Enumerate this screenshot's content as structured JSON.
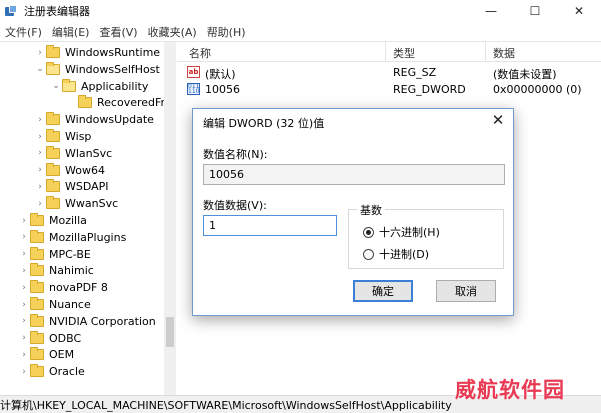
{
  "window": {
    "title": "注册表编辑器",
    "minimize": "—",
    "maximize": "☐",
    "close": "✕"
  },
  "menu": [
    "文件(F)",
    "编辑(E)",
    "查看(V)",
    "收藏夹(A)",
    "帮助(H)"
  ],
  "tree": [
    {
      "label": "WindowsRuntime",
      "depth": 3,
      "chev": "›",
      "open": false
    },
    {
      "label": "WindowsSelfHost",
      "depth": 3,
      "chev": "⌄",
      "open": true
    },
    {
      "label": "Applicability",
      "depth": 4,
      "chev": "⌄",
      "open": true
    },
    {
      "label": "RecoveredFr",
      "depth": 5,
      "chev": "",
      "open": false,
      "selected": true
    },
    {
      "label": "WindowsUpdate",
      "depth": 3,
      "chev": "›",
      "open": false
    },
    {
      "label": "Wisp",
      "depth": 3,
      "chev": "›",
      "open": false
    },
    {
      "label": "WlanSvc",
      "depth": 3,
      "chev": "›",
      "open": false
    },
    {
      "label": "Wow64",
      "depth": 3,
      "chev": "›",
      "open": false
    },
    {
      "label": "WSDAPI",
      "depth": 3,
      "chev": "›",
      "open": false
    },
    {
      "label": "WwanSvc",
      "depth": 3,
      "chev": "›",
      "open": false
    },
    {
      "label": "Mozilla",
      "depth": 2,
      "chev": "›",
      "open": false
    },
    {
      "label": "MozillaPlugins",
      "depth": 2,
      "chev": "›",
      "open": false
    },
    {
      "label": "MPC-BE",
      "depth": 2,
      "chev": "›",
      "open": false
    },
    {
      "label": "Nahimic",
      "depth": 2,
      "chev": "›",
      "open": false
    },
    {
      "label": "novaPDF 8",
      "depth": 2,
      "chev": "›",
      "open": false
    },
    {
      "label": "Nuance",
      "depth": 2,
      "chev": "›",
      "open": false
    },
    {
      "label": "NVIDIA Corporation",
      "depth": 2,
      "chev": "›",
      "open": false
    },
    {
      "label": "ODBC",
      "depth": 2,
      "chev": "›",
      "open": false
    },
    {
      "label": "OEM",
      "depth": 2,
      "chev": "›",
      "open": false
    },
    {
      "label": "Oracle",
      "depth": 2,
      "chev": "›",
      "open": false
    }
  ],
  "list": {
    "columns": [
      "名称",
      "类型",
      "数据"
    ],
    "rows": [
      {
        "icon": "string-value-icon",
        "icon_text": "ab",
        "name": "(默认)",
        "type": "REG_SZ",
        "data": "(数值未设置)"
      },
      {
        "icon": "binary-value-icon",
        "icon_text": "011\n110",
        "name": "10056",
        "type": "REG_DWORD",
        "data": "0x00000000 (0)"
      }
    ]
  },
  "status": "计算机\\HKEY_LOCAL_MACHINE\\SOFTWARE\\Microsoft\\WindowsSelfHost\\Applicability",
  "watermark": "威航软件园",
  "dialog": {
    "title": "编辑 DWORD (32 位)值",
    "close": "✕",
    "name_label": "数值名称(N):",
    "name_value": "10056",
    "data_label": "数值数据(V):",
    "data_value": "1",
    "base_label": "基数",
    "hex_label": "十六进制(H)",
    "dec_label": "十进制(D)",
    "ok": "确定",
    "cancel": "取消"
  }
}
